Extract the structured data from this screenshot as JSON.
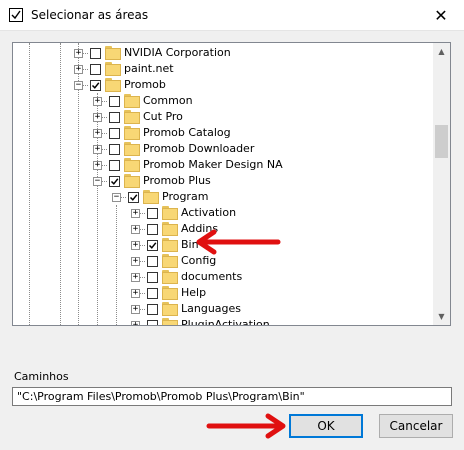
{
  "window": {
    "title": "Selecionar as áreas",
    "close_glyph": "✕"
  },
  "tree": {
    "items": [
      {
        "label": "NVIDIA Corporation",
        "checked": false,
        "expander": "+"
      },
      {
        "label": "paint.net",
        "checked": false,
        "expander": "+"
      },
      {
        "label": "Promob",
        "checked": true,
        "expander": "-"
      },
      {
        "label": "Common",
        "checked": false,
        "expander": "+"
      },
      {
        "label": "Cut Pro",
        "checked": false,
        "expander": "+"
      },
      {
        "label": "Promob Catalog",
        "checked": false,
        "expander": "+"
      },
      {
        "label": "Promob Downloader",
        "checked": false,
        "expander": "+"
      },
      {
        "label": "Promob Maker Design NA",
        "checked": false,
        "expander": "+"
      },
      {
        "label": "Promob Plus",
        "checked": true,
        "expander": "-"
      },
      {
        "label": "Program",
        "checked": true,
        "expander": "-"
      },
      {
        "label": "Activation",
        "checked": false,
        "expander": "+"
      },
      {
        "label": "Addins",
        "checked": false,
        "expander": "+"
      },
      {
        "label": "Bin",
        "checked": true,
        "expander": "+"
      },
      {
        "label": "Config",
        "checked": false,
        "expander": "+"
      },
      {
        "label": "documents",
        "checked": false,
        "expander": "+"
      },
      {
        "label": "Help",
        "checked": false,
        "expander": "+"
      },
      {
        "label": "Languages",
        "checked": false,
        "expander": "+"
      },
      {
        "label": "PluginActivation",
        "checked": false,
        "expander": "+"
      }
    ]
  },
  "paths": {
    "label": "Caminhos",
    "value": "\"C:\\Program Files\\Promob\\Promob Plus\\Program\\Bin\""
  },
  "buttons": {
    "ok": "OK",
    "cancel": "Cancelar"
  },
  "icons": {
    "window": "checkbox-window-icon",
    "folder": "folder-icon",
    "arrow": "red-arrow-annotation",
    "scroll_up": "scroll-up-icon",
    "scroll_down": "scroll-down-icon"
  },
  "colors": {
    "folder": "#f8d775",
    "accent": "#0078d7",
    "annotation": "#e01010"
  }
}
